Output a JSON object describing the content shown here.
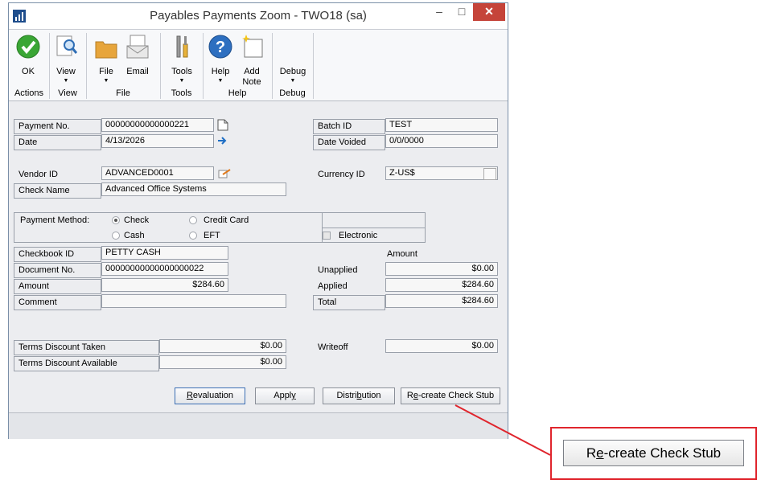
{
  "window": {
    "title": "Payables Payments Zoom  -  TWO18 (sa)",
    "minimize": "–",
    "maximize": "□",
    "close": "✕"
  },
  "ribbon": {
    "buttons": [
      {
        "label": "OK",
        "icon": "checkmark-icon"
      },
      {
        "label": "View",
        "icon": "view-icon"
      },
      {
        "label": "File",
        "icon": "folder-icon"
      },
      {
        "label": "Email",
        "icon": "email-icon"
      },
      {
        "label": "Tools",
        "icon": "tools-icon"
      },
      {
        "label": "Help",
        "icon": "help-icon"
      },
      {
        "label": "Add",
        "label2": "Note",
        "icon": "note-icon"
      },
      {
        "label": "Debug",
        "icon": "debug-icon"
      }
    ],
    "groups": [
      "Actions",
      "View",
      "File",
      "Tools",
      "Help",
      "Debug"
    ]
  },
  "form": {
    "payment_no_label": "Payment No.",
    "payment_no": "00000000000000221",
    "date_label": "Date",
    "date": "4/13/2026",
    "batch_id_label": "Batch ID",
    "batch_id": "TEST",
    "date_voided_label": "Date Voided",
    "date_voided": "0/0/0000",
    "vendor_id_label": "Vendor ID",
    "vendor_id": "ADVANCED0001",
    "check_name_label": "Check Name",
    "check_name": "Advanced Office Systems",
    "currency_id_label": "Currency ID",
    "currency_id": "Z-US$",
    "payment_method_label": "Payment Method:",
    "method_check": "Check",
    "method_credit_card": "Credit Card",
    "method_cash": "Cash",
    "method_eft": "EFT",
    "electronic_label": "Electronic",
    "checkbook_id_label": "Checkbook ID",
    "checkbook_id": "PETTY CASH",
    "document_no_label": "Document No.",
    "document_no": "00000000000000000022",
    "amount_label": "Amount",
    "amount": "$284.60",
    "comment_label": "Comment",
    "comment": "",
    "amount_header": "Amount",
    "unapplied_label": "Unapplied",
    "unapplied": "$0.00",
    "applied_label": "Applied",
    "applied": "$284.60",
    "total_label": "Total",
    "total": "$284.60",
    "terms_taken_label": "Terms Discount Taken",
    "terms_taken": "$0.00",
    "terms_available_label": "Terms Discount Available",
    "terms_available": "$0.00",
    "writeoff_label": "Writeoff",
    "writeoff": "$0.00"
  },
  "buttons": {
    "revaluation_u": "R",
    "revaluation_rest": "evaluation",
    "apply_pre": "Appl",
    "apply_u": "y",
    "distribution_pre": "Distri",
    "distribution_u": "b",
    "distribution_rest": "ution",
    "recreate_pre": "R",
    "recreate_u": "e",
    "recreate_rest": "-create Check Stub"
  },
  "callout": {
    "pre": "R",
    "u": "e",
    "rest": "-create Check Stub",
    "color": "#e0252d"
  }
}
